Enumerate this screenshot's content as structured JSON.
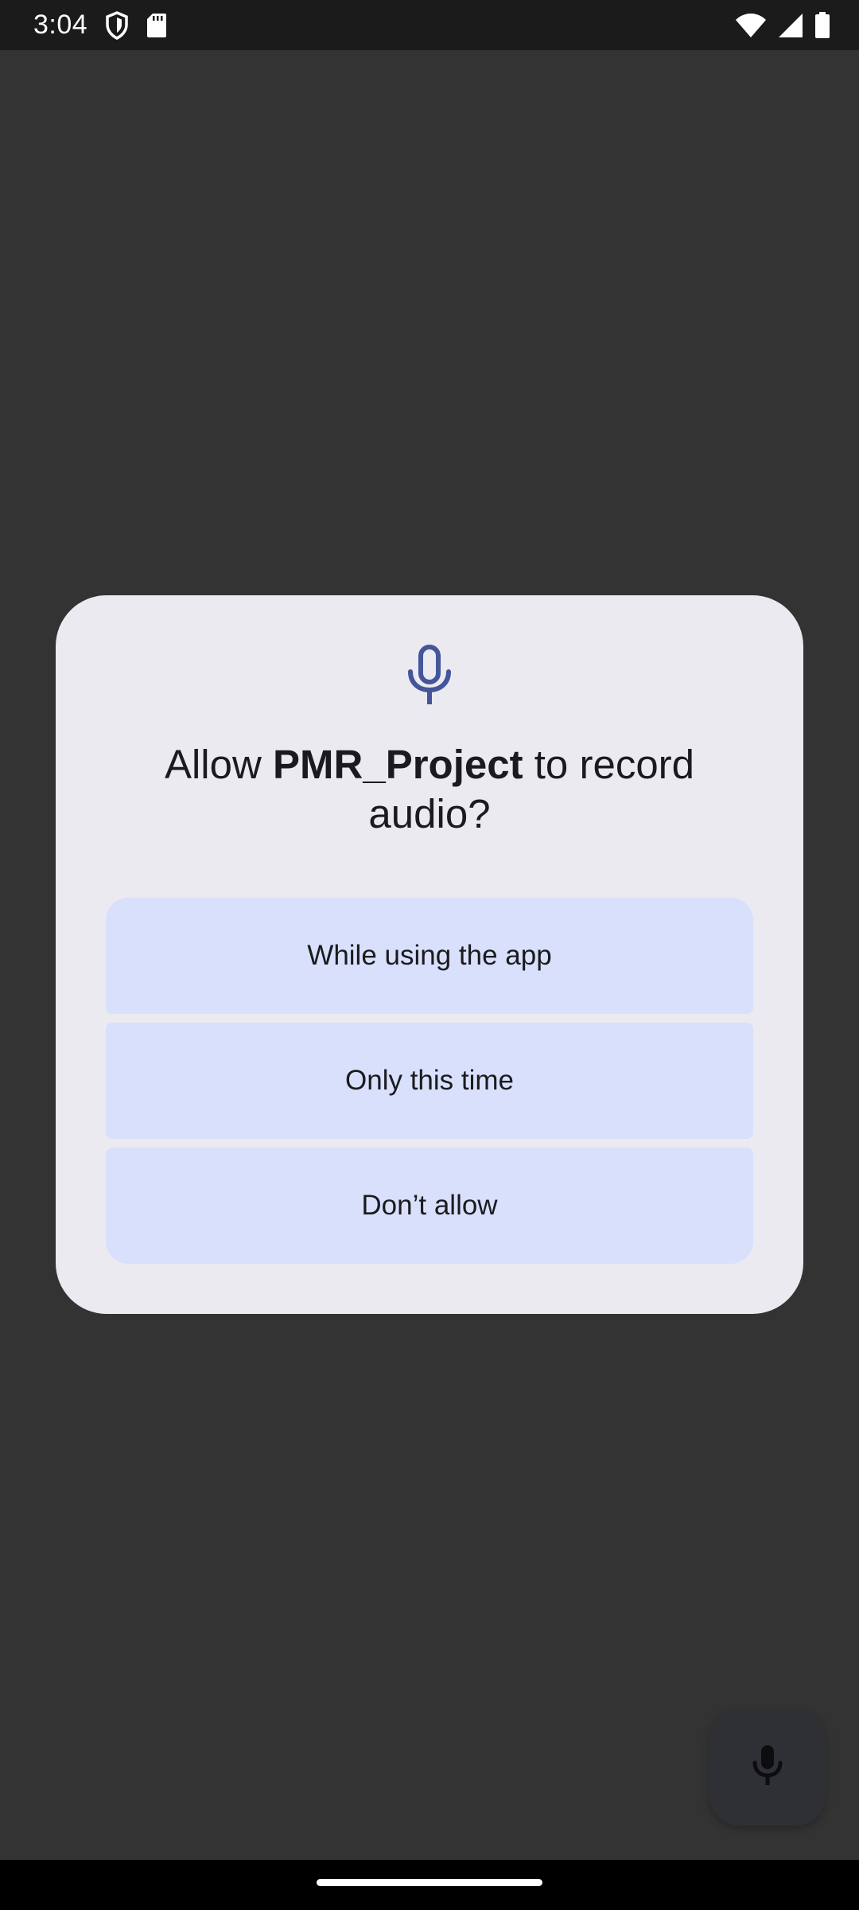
{
  "status_bar": {
    "time": "3:04",
    "icons": [
      "shield-icon",
      "sd-card-icon",
      "wifi-icon",
      "cellular-signal-icon",
      "battery-icon"
    ]
  },
  "dialog": {
    "icon": "microphone-icon",
    "title_prefix": "Allow ",
    "app_name": "PMR_Project",
    "title_suffix": " to record audio?",
    "buttons": {
      "while_using": "While using the app",
      "only_this_time": "Only this time",
      "dont_allow": "Don’t allow"
    }
  },
  "fab": {
    "icon": "microphone-icon"
  },
  "colors": {
    "background": "#333333",
    "dialog_surface": "#eceaf1",
    "button_fill": "#d9e0fc",
    "icon_accent": "#44559a"
  }
}
